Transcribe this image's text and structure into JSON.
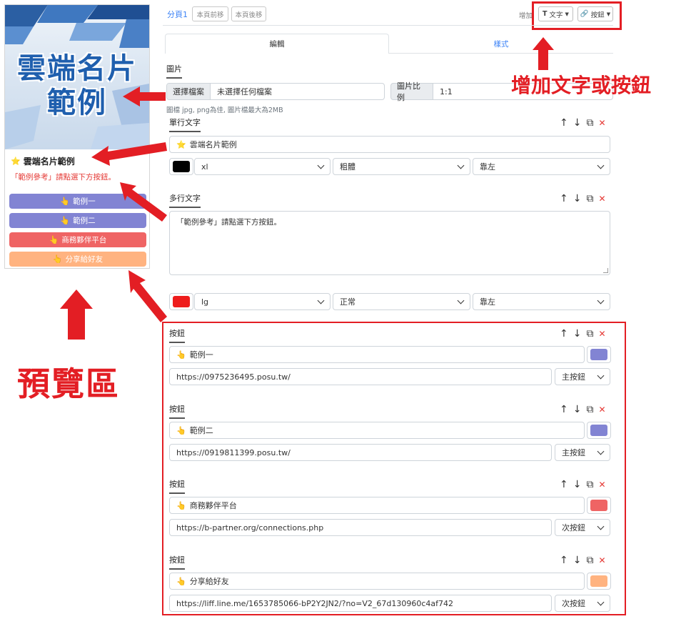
{
  "preview": {
    "banner_line1": "雲端名片",
    "banner_line2": "範例",
    "title": "雲端名片範例",
    "subtitle": "「範例參考」請點選下方按鈕。",
    "buttons": [
      {
        "label": "範例一",
        "color": "#8284d3"
      },
      {
        "label": "範例二",
        "color": "#8284d3"
      },
      {
        "label": "商務夥伴平台",
        "color": "#ef6464"
      },
      {
        "label": "分享給好友",
        "color": "#ffb380"
      }
    ]
  },
  "toolbar": {
    "page_tab": "分頁1",
    "move_prev": "本頁前移",
    "move_next": "本頁後移",
    "add_label": "增加",
    "add_text": "文字",
    "add_button": "按鈕"
  },
  "tabs": {
    "edit": "編輯",
    "style": "樣式"
  },
  "image_section": {
    "title": "圖片",
    "choose_file": "選擇檔案",
    "no_file": "未選擇任何檔案",
    "ratio_label": "圖片比例",
    "ratio_value": "1:1",
    "hint": "圖檔 jpg, png為佳, 圖片檔最大為2MB"
  },
  "single_text": {
    "title": "單行文字",
    "value": "雲端名片範例",
    "color": "#000000",
    "size": "xl",
    "weight": "粗體",
    "align": "靠左"
  },
  "multi_text": {
    "title": "多行文字",
    "value": "「範例參考」請點選下方按鈕。",
    "color": "#ee1c1c",
    "size": "lg",
    "weight": "正常",
    "align": "靠左"
  },
  "button_blocks": [
    {
      "title": "按鈕",
      "label": "範例一",
      "url": "https://0975236495.posu.tw/",
      "type": "主按鈕",
      "color": "#8284d3"
    },
    {
      "title": "按鈕",
      "label": "範例二",
      "url": "https://0919811399.posu.tw/",
      "type": "主按鈕",
      "color": "#8284d3"
    },
    {
      "title": "按鈕",
      "label": "商務夥伴平台",
      "url": "https://b-partner.org/connections.php",
      "type": "次按鈕",
      "color": "#ef6464"
    },
    {
      "title": "按鈕",
      "label": "分享給好友",
      "url": "https://liff.line.me/1653785066-bP2Y2JN2/?no=V2_67d130960c4af742",
      "type": "次按鈕",
      "color": "#ffb380"
    }
  ],
  "annotations": {
    "add_text_or_button": "增加文字或按鈕",
    "preview_area": "預覽區"
  },
  "colors": {
    "accent": "#3b82f6",
    "annotation_red": "#e31e24"
  }
}
